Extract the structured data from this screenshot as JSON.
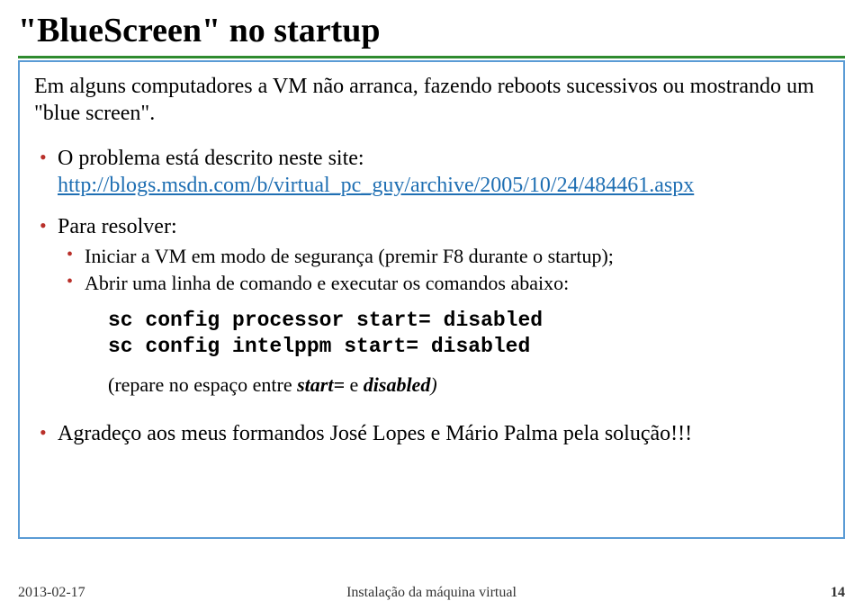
{
  "title": "\"BlueScreen\" no startup",
  "intro": "Em alguns computadores a VM não arranca, fazendo reboots sucessivos ou mostrando um \"blue screen\".",
  "bullets": [
    {
      "text_before_link": "O problema está descrito neste site: ",
      "link": "http://blogs.msdn.com/b/virtual_pc_guy/archive/2005/10/24/484461.aspx"
    }
  ],
  "resolver_label": "Para resolver:",
  "resolver_items": [
    "Iniciar a VM em modo de segurança (premir F8 durante o startup);",
    "Abrir uma linha de comando e executar os comandos abaixo:"
  ],
  "code_lines": [
    "sc config processor start= disabled",
    "sc config intelppm start= disabled"
  ],
  "note_prefix": "(repare no espaço entre ",
  "note_em1": "start=",
  "note_mid": " e ",
  "note_em2": "disabled",
  "note_suffix": ")",
  "thanks": "Agradeço aos meus formandos José Lopes e Mário Palma pela solução!!!",
  "footer": {
    "date": "2013-02-17",
    "center": "Instalação da máquina virtual",
    "page": "14"
  }
}
